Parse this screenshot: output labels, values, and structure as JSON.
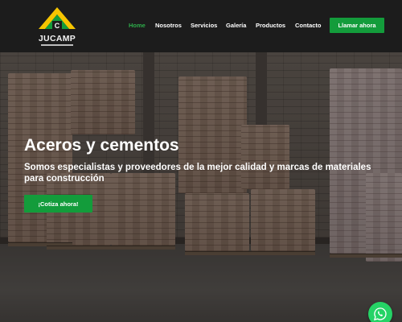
{
  "brand": {
    "name": "JUCAMP"
  },
  "nav": {
    "items": [
      {
        "label": "Home",
        "active": true
      },
      {
        "label": "Nosotros",
        "active": false
      },
      {
        "label": "Servicios",
        "active": false
      },
      {
        "label": "Galería",
        "active": false
      },
      {
        "label": "Productos",
        "active": false
      },
      {
        "label": "Contacto",
        "active": false
      }
    ],
    "call_label": "Llamar ahora"
  },
  "hero": {
    "title": "Aceros y cementos",
    "subtitle": "Somos especialistas y proveedores de la mejor calidad y marcas de materiales para construcción",
    "cta_label": "¡Cotiza ahora!"
  },
  "icons": {
    "floating": "whatsapp-icon",
    "logo": "house-roof-logo-icon"
  },
  "colors": {
    "accent": "#139c3b",
    "active_nav": "#2eab4a",
    "header_bg": "#1c1c1c",
    "logo_yellow": "#f5c400"
  }
}
